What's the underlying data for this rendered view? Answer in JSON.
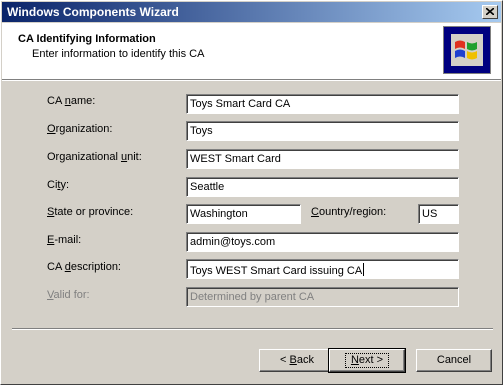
{
  "window": {
    "title": "Windows Components Wizard"
  },
  "header": {
    "title": "CA Identifying Information",
    "subtitle": "Enter information to identify this CA"
  },
  "form": {
    "ca_name": {
      "label_pre": "CA ",
      "label_ul": "n",
      "label_post": "ame:",
      "value": "Toys Smart Card CA"
    },
    "organization": {
      "label_pre": "",
      "label_ul": "O",
      "label_post": "rganization:",
      "value": "Toys"
    },
    "org_unit": {
      "label_pre": "Organizational ",
      "label_ul": "u",
      "label_post": "nit:",
      "value": "WEST Smart Card"
    },
    "city": {
      "label_pre": "Ci",
      "label_ul": "t",
      "label_post": "y:",
      "value": "Seattle"
    },
    "state": {
      "label_pre": "",
      "label_ul": "S",
      "label_post": "tate or province:",
      "value": "Washington"
    },
    "country": {
      "label_pre": "",
      "label_ul": "C",
      "label_post": "ountry/region:",
      "value": "US"
    },
    "email": {
      "label_pre": "",
      "label_ul": "E",
      "label_post": "-mail:",
      "value": "admin@toys.com"
    },
    "ca_description": {
      "label_pre": "CA ",
      "label_ul": "d",
      "label_post": "escription:",
      "value": "Toys WEST Smart Card issuing CA"
    },
    "valid_for": {
      "label_pre": "",
      "label_ul": "V",
      "label_post": "alid for:",
      "value": "Determined by parent CA"
    }
  },
  "buttons": {
    "back": {
      "pre": "< ",
      "ul": "B",
      "post": "ack"
    },
    "next": {
      "pre": "",
      "ul": "N",
      "post": "ext >"
    },
    "cancel": {
      "label": "Cancel"
    }
  },
  "icons": {
    "close": "close-icon",
    "logo": "windows-logo-icon"
  }
}
